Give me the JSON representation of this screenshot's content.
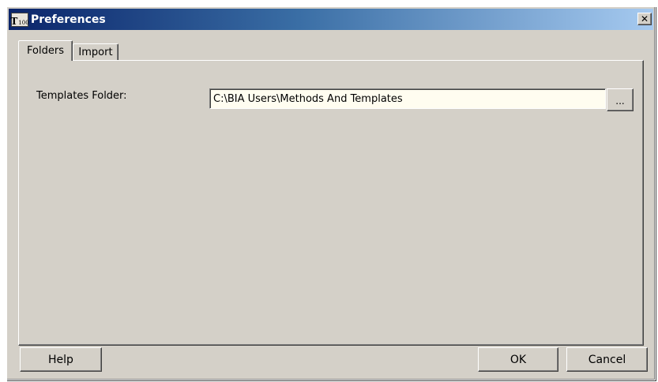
{
  "window": {
    "title": "Preferences",
    "icon_letter": "T",
    "icon_sub": "100",
    "close_label": "✕"
  },
  "tabs": [
    {
      "label": "Folders",
      "active": true
    },
    {
      "label": "Import",
      "active": false
    }
  ],
  "folders_panel": {
    "templates_folder_label": "Templates Folder:",
    "templates_folder_value": "C:\\BIA Users\\Methods And Templates",
    "browse_label": "..."
  },
  "buttons": {
    "help": "Help",
    "ok": "OK",
    "cancel": "Cancel"
  },
  "colors": {
    "title_gradient_start": "#0a246a",
    "title_gradient_end": "#a6caf0",
    "dialog_face": "#d4d0c8",
    "input_background": "#fffdf0"
  }
}
